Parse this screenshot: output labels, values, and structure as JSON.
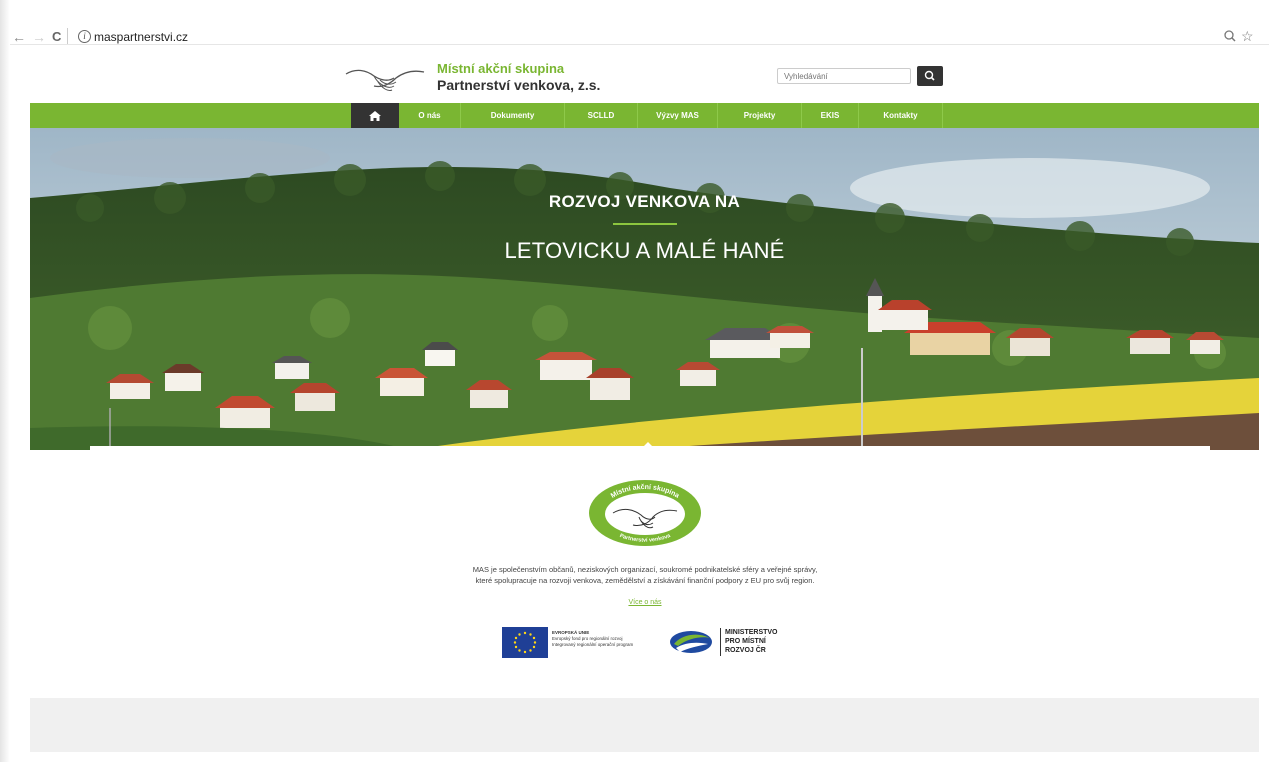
{
  "browser": {
    "url": "maspartnerstvi.cz",
    "back_glyph": "←",
    "forward_glyph": "→",
    "reload_glyph": "C",
    "info_glyph": "i",
    "zoom_glyph": "🔍",
    "star_glyph": "☆"
  },
  "header": {
    "title_line1": "Místní akční skupina",
    "title_line2": "Partnerství venkova, z.s.",
    "search_placeholder": "Vyhledávání"
  },
  "nav": {
    "items": [
      "O nás",
      "Dokumenty",
      "SCLLD",
      "Výzvy MAS",
      "Projekty",
      "EKIS",
      "Kontakty"
    ]
  },
  "hero": {
    "title_line1": "ROZVOJ VENKOVA NA",
    "title_line2": "LETOVICKU A MALÉ HANÉ"
  },
  "center_logo": {
    "text_top": "Místní akční skupina",
    "text_bottom": "Partnerství venkova"
  },
  "about": {
    "description": "MAS je společenstvím občanů, neziskových organizací, soukromé podnikatelské sféry a veřejné správy, které spolupracuje na rozvoji venkova, zemědělství a získávání finanční podpory z EU pro svůj region.",
    "more_link": "Více o nás"
  },
  "partners": {
    "eu_line1": "EVROPSKÁ UNIE",
    "eu_line2": "Evropský fond pro regionální rozvoj",
    "eu_line3": "Integrovaný regionální operační program",
    "mmr_line1": "MINISTERSTVO",
    "mmr_line2": "PRO MÍSTNÍ",
    "mmr_line3": "ROZVOJ ČR"
  },
  "colors": {
    "brand_green": "#7ab632",
    "nav_dark": "#333333",
    "footer_gray": "#f0f0f0"
  },
  "icons": [
    "home-icon",
    "search-icon",
    "handshake-icon",
    "eu-flag-icon",
    "mmr-logo-icon"
  ]
}
